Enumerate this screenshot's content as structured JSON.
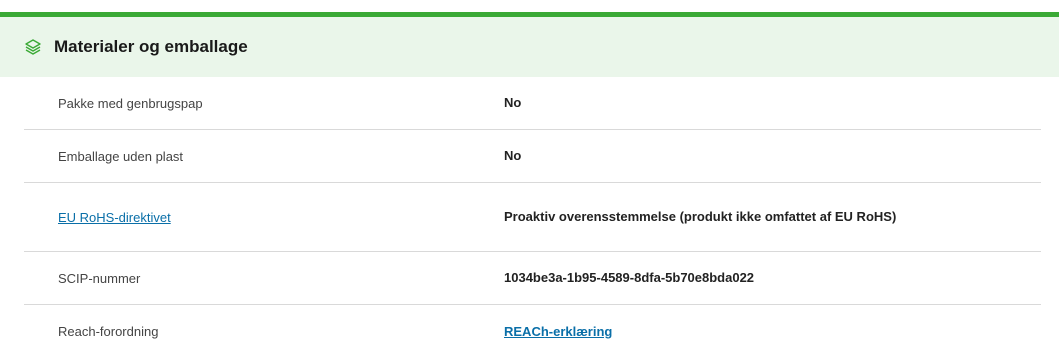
{
  "section": {
    "title": "Materialer og emballage",
    "icon": "layers-icon",
    "accent_color": "#3aa935",
    "header_bg": "#eaf6ea"
  },
  "rows": [
    {
      "label": "Pakke med genbrugspap",
      "value": "No"
    },
    {
      "label": "Emballage uden plast",
      "value": "No"
    },
    {
      "label": "EU RoHS-direktivet",
      "value": "Proaktiv overensstemmelse (produkt ikke omfattet af  EU RoHS)"
    },
    {
      "label": "SCIP-nummer",
      "value": "1034be3a-1b95-4589-8dfa-5b70e8bda022"
    },
    {
      "label": "Reach-forordning",
      "value": "REACh-erklæring"
    }
  ],
  "link_color": "#0a6fa8"
}
